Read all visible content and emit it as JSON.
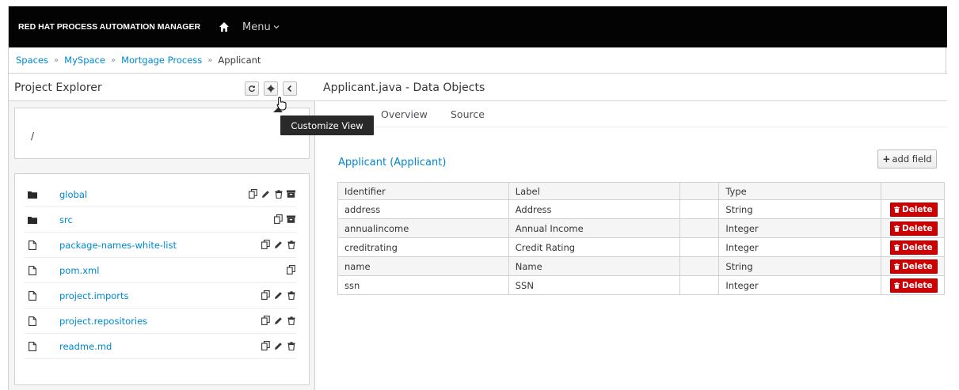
{
  "navbar": {
    "brand": "RED HAT PROCESS AUTOMATION MANAGER",
    "home_icon": "home-icon",
    "menu_label": "Menu"
  },
  "breadcrumb": {
    "items": [
      "Spaces",
      "MySpace",
      "Mortgage Process"
    ],
    "current": "Applicant",
    "separator": "»"
  },
  "project_explorer": {
    "title": "Project Explorer",
    "path": "/",
    "tooltip": "Customize View",
    "files": [
      {
        "name": "global",
        "type": "folder"
      },
      {
        "name": "src",
        "type": "folder"
      },
      {
        "name": "package-names-white-list",
        "type": "file"
      },
      {
        "name": "pom.xml",
        "type": "file"
      },
      {
        "name": "project.imports",
        "type": "file"
      },
      {
        "name": "project.repositories",
        "type": "file"
      },
      {
        "name": "readme.md",
        "type": "file"
      }
    ]
  },
  "editor": {
    "title": "Applicant.java - Data Objects",
    "tabs": [
      "Overview",
      "Source"
    ],
    "object_title": "Applicant (Applicant)",
    "add_field_label": "add field",
    "columns": [
      "Identifier",
      "Label",
      "",
      "Type",
      ""
    ],
    "rows": [
      {
        "identifier": "address",
        "label": "Address",
        "type": "String"
      },
      {
        "identifier": "annualincome",
        "label": "Annual Income",
        "type": "Integer"
      },
      {
        "identifier": "creditrating",
        "label": "Credit Rating",
        "type": "Integer"
      },
      {
        "identifier": "name",
        "label": "Name",
        "type": "String"
      },
      {
        "identifier": "ssn",
        "label": "SSN",
        "type": "Integer"
      }
    ],
    "delete_label": "Delete"
  },
  "colors": {
    "navbar_bg": "#030303",
    "link": "#0088ce",
    "delete_bg": "#cc0000"
  }
}
